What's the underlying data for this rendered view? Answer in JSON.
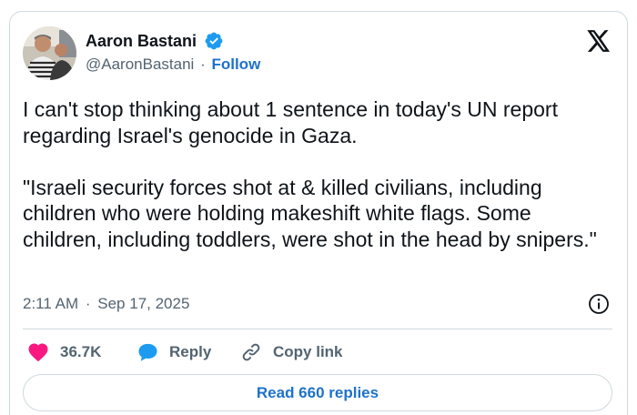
{
  "author": {
    "display_name": "Aaron Bastani",
    "handle": "@AaronBastani",
    "separator": "·",
    "follow_label": "Follow",
    "verified": true
  },
  "tweet": {
    "text": "I can't stop thinking about 1 sentence in today's UN report regarding Israel's genocide in Gaza.\n\n\"Israeli security forces shot at & killed civilians, including children who were holding makeshift white flags. Some children, including toddlers, were shot in the head by snipers.\"",
    "time": "2:11 AM",
    "separator": "·",
    "date": "Sep 17, 2025"
  },
  "actions": {
    "like_count": "36.7K",
    "reply_label": "Reply",
    "copy_link_label": "Copy link",
    "read_replies_label": "Read 660 replies"
  },
  "icons": {
    "like": "heart-icon",
    "reply": "speech-bubble-icon",
    "copy": "link-icon",
    "info": "info-icon",
    "brand": "x-logo-icon",
    "verified": "verified-badge-icon"
  },
  "colors": {
    "heart": "#f91880",
    "reply": "#1d9bf0",
    "link_text": "#1d72c9",
    "verified": "#1d9bf0",
    "secondary_text": "#536471",
    "border": "#cfd9de"
  }
}
